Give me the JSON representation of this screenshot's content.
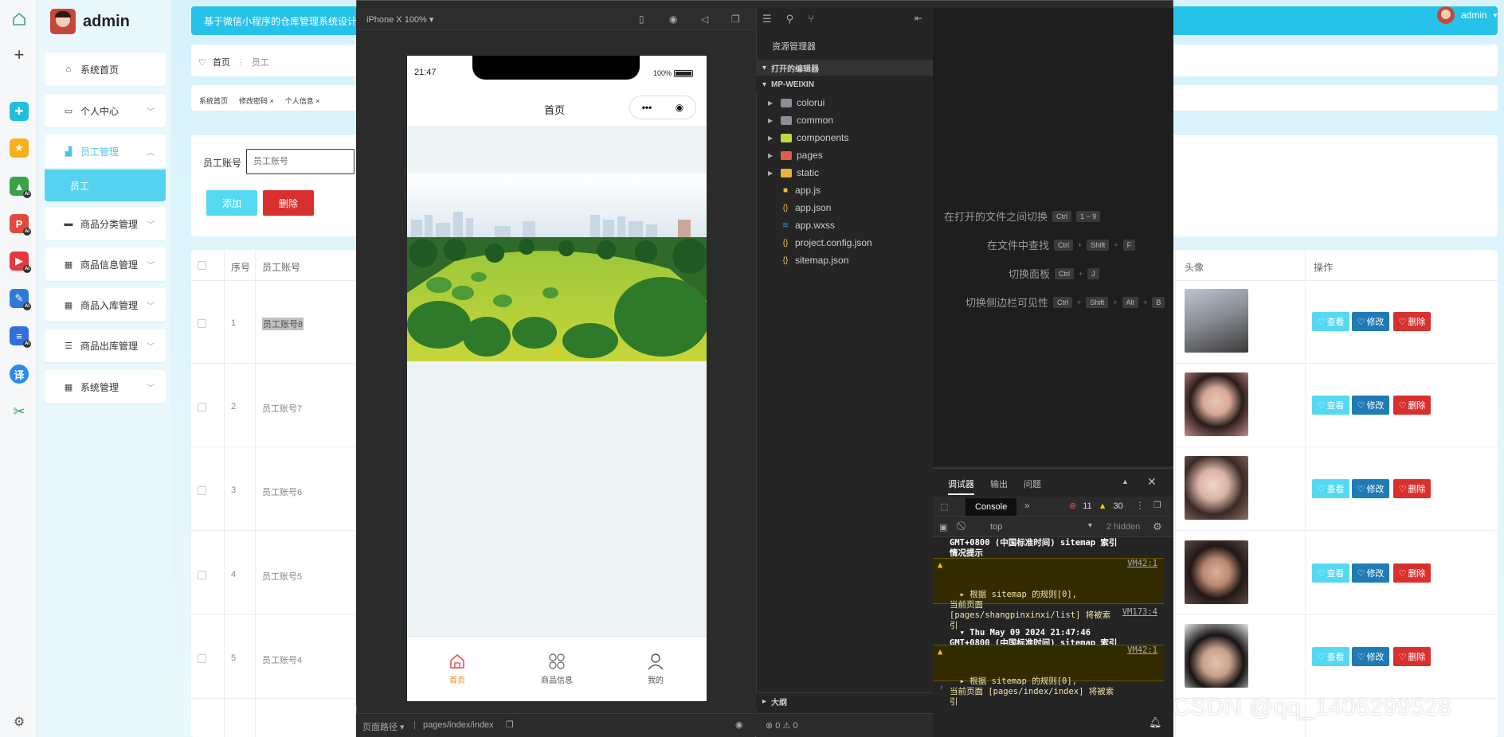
{
  "admin": {
    "title": "admin",
    "topbar_text": "基于微信小程序的仓库管理系统设计与",
    "user": "admin",
    "menu": [
      {
        "label": "系统首页",
        "icon": "home-icon"
      },
      {
        "label": "个人中心",
        "icon": "person-icon"
      },
      {
        "label": "员工管理",
        "icon": "chart-icon"
      },
      {
        "label": "商品分类管理",
        "icon": "briefcase-icon"
      },
      {
        "label": "商品信息管理",
        "icon": "grid-icon"
      },
      {
        "label": "商品入库管理",
        "icon": "grid-icon"
      },
      {
        "label": "商品出库管理",
        "icon": "list-icon"
      },
      {
        "label": "系统管理",
        "icon": "grid-icon"
      }
    ],
    "submenu_item": "员工",
    "breadcrumb": {
      "home": "首页",
      "current": "员工"
    },
    "tags": [
      "系统首页",
      "修改密码 ×",
      "个人信息 ×"
    ],
    "search": {
      "label": "员工账号",
      "placeholder": "员工账号"
    },
    "buttons": {
      "add": "添加",
      "delete": "删除"
    },
    "table": {
      "headers": {
        "index": "序号",
        "account": "员工账号",
        "avatar": "头像",
        "ops": "操作"
      },
      "rows": [
        {
          "index": "1",
          "account": "员工账号8"
        },
        {
          "index": "2",
          "account": "员工账号7"
        },
        {
          "index": "3",
          "account": "员工账号6"
        },
        {
          "index": "4",
          "account": "员工账号5"
        },
        {
          "index": "5",
          "account": "员工账号4"
        }
      ],
      "actions": {
        "view": "查看",
        "edit": "修改",
        "delete": "删除"
      }
    }
  },
  "devtools": {
    "device": "iPhone X 100% ▾",
    "phone": {
      "time": "21:47",
      "battery": "100%",
      "page_title": "首页",
      "tabs": [
        {
          "label": "首页",
          "icon": "home-icon"
        },
        {
          "label": "商品信息",
          "icon": "grid-icon"
        },
        {
          "label": "我的",
          "icon": "person-icon"
        }
      ]
    },
    "page_path_label": "页面路径 ▾",
    "page_path": "pages/index/index",
    "explorer": {
      "title": "资源管理器",
      "open_editors": "打开的编辑器",
      "project": "MP-WEIXIN",
      "folders": [
        "colorui",
        "common",
        "components",
        "pages",
        "static"
      ],
      "files": [
        "app.js",
        "app.json",
        "app.wxss",
        "project.config.json",
        "sitemap.json"
      ],
      "outline": "大纲",
      "footer": "⊗ 0 ⚠ 0"
    },
    "shortcuts": [
      {
        "label": "在打开的文件之间切换",
        "keys": [
          "Ctrl",
          "1 ~ 9"
        ]
      },
      {
        "label": "在文件中查找",
        "keys": [
          "Ctrl",
          "Shift",
          "F"
        ]
      },
      {
        "label": "切换面板",
        "keys": [
          "Ctrl",
          "J"
        ]
      },
      {
        "label": "切换侧边栏可见性",
        "keys": [
          "Ctrl",
          "Shift",
          "Alt",
          "B"
        ]
      }
    ],
    "console": {
      "tabs": [
        "调试器",
        "输出",
        "问题"
      ],
      "console_tab": "Console",
      "errors": "11",
      "warnings": "30",
      "context": "top",
      "hidden": "2 hidden",
      "logs": [
        {
          "type": "info",
          "text": "GMT+0800 (中国标准时间) sitemap 索引\n情况提示"
        },
        {
          "type": "warn",
          "text": "▸ 根据 sitemap 的规则[0],\n当前页面\n[pages/shangpinxinxi/list] 将被索\n引",
          "link": "VM42:1"
        },
        {
          "type": "info",
          "text": "▾ Thu May 09 2024 21:47:46\nGMT+0800 (中国标准时间) sitemap 索引\n情况提示",
          "link": "VM173:4"
        },
        {
          "type": "warn",
          "text": "▸ 根据 sitemap 的规则[0],\n当前页面 [pages/index/index] 将被索\n引",
          "link": "VM42:1"
        }
      ]
    }
  },
  "watermark": "CSDN @qq_1406299528"
}
